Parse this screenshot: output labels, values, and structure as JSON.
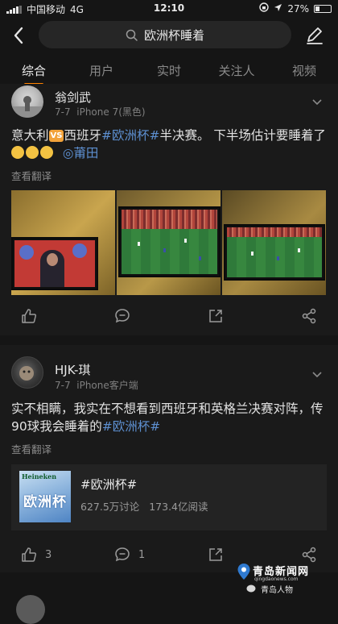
{
  "status_bar": {
    "carrier": "中国移动",
    "network": "4G",
    "time": "12:10",
    "battery_text": "27%",
    "battery_level": 0.27
  },
  "search": {
    "query": "欧洲杯睡着"
  },
  "tabs": [
    {
      "label": "综合",
      "active": true
    },
    {
      "label": "用户",
      "active": false
    },
    {
      "label": "实时",
      "active": false
    },
    {
      "label": "关注人",
      "active": false
    },
    {
      "label": "视频",
      "active": false
    }
  ],
  "posts": [
    {
      "username": "翁剑武",
      "date": "7-7",
      "source": "iPhone 7(黑色)",
      "text_parts": {
        "p1": "意大利",
        "vs": "VS",
        "p2": "西班牙",
        "hashtag": "#欧洲杯#",
        "p3": "半决赛。 下半场估计要睡着了",
        "location": "◎莆田"
      },
      "translate": "查看翻译",
      "photo_count": 3
    },
    {
      "username": "HJK-琪",
      "date": "7-7",
      "source": "iPhone客户端",
      "text_parts": {
        "p1": "实不相瞒，我实在不想看到西班牙和英格兰决赛对阵，传90球我会睡着的",
        "hashtag": "#欧洲杯#"
      },
      "translate": "查看翻译",
      "topic": {
        "title": "#欧洲杯#",
        "discussions": "627.5万讨论",
        "reads": "173.4亿阅读",
        "image_brand": "Heineken",
        "image_text": "欧洲杯"
      },
      "likes": "3",
      "comments": "1"
    }
  ],
  "watermark": {
    "site": "青岛新闻网",
    "url": "qingdaonews.com",
    "brand": "青岛人物"
  },
  "colors": {
    "background": "#151515",
    "accent_tab": "#ff8200",
    "link": "#5d8fd0"
  }
}
